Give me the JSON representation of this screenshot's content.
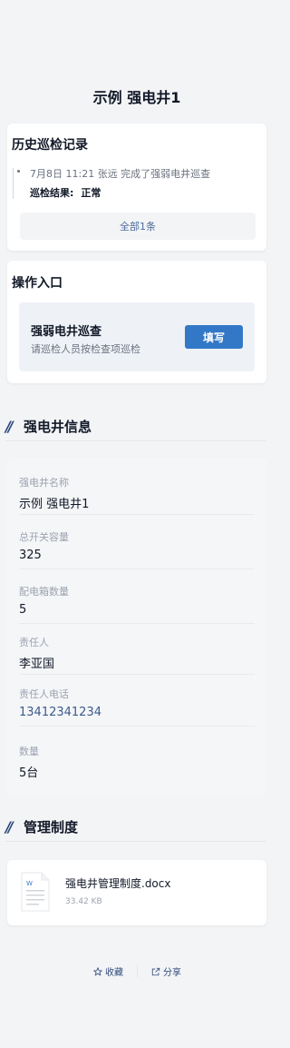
{
  "page": {
    "title": "示例 强电井1"
  },
  "history": {
    "title": "历史巡检记录",
    "records": [
      {
        "text": "7月8日 11:21  张远  完成了强弱电井巡查",
        "result_label": "巡检结果:",
        "result_value": "正常"
      }
    ],
    "all_label": "全部1条"
  },
  "operations": {
    "title": "操作入口",
    "items": [
      {
        "name": "强弱电井巡查",
        "desc": "请巡检人员按检查项巡检",
        "button": "填写"
      }
    ]
  },
  "info_section": {
    "title": "强电井信息",
    "fields": [
      {
        "label": "强电井名称",
        "value": "示例 强电井1"
      },
      {
        "label": "总开关容量",
        "value": "325"
      },
      {
        "label": "配电箱数量",
        "value": "5"
      },
      {
        "label": "责任人",
        "value": "李亚国"
      },
      {
        "label": "责任人电话",
        "value": "13412341234"
      },
      {
        "label": "数量",
        "value": "5台"
      }
    ]
  },
  "docs_section": {
    "title": "管理制度",
    "files": [
      {
        "name": "强电井管理制度.docx",
        "size": "33.42 KB",
        "icon": "word-doc-icon"
      }
    ]
  },
  "footer": {
    "favorite": "收藏",
    "share": "分享"
  },
  "colors": {
    "accent": "#3378c6",
    "link": "#3d5a8c",
    "section_slash": "#2f4a7a"
  }
}
